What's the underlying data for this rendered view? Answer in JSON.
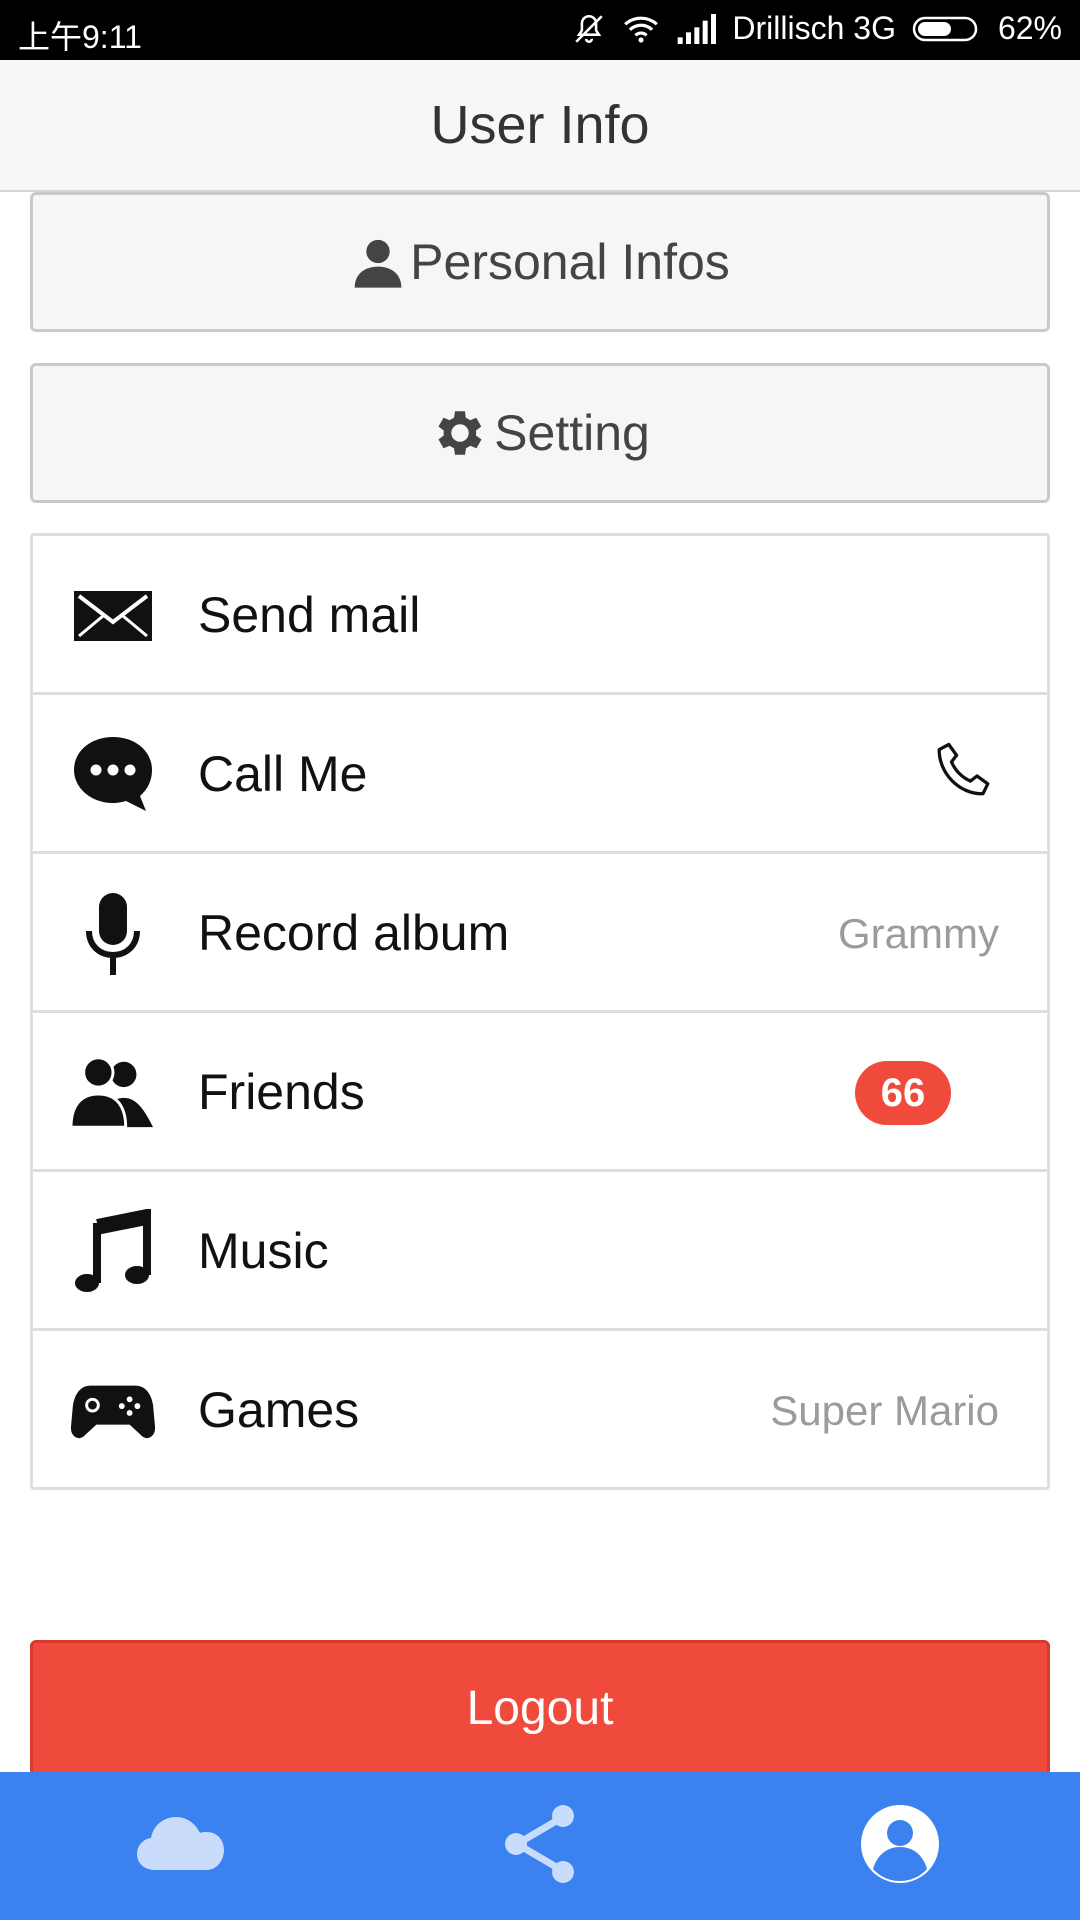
{
  "status_bar": {
    "time": "上午9:11",
    "carrier": "Drillisch 3G",
    "battery": "62%",
    "battery_level": 0.62,
    "icons": [
      "bell-off-icon",
      "wifi-icon",
      "signal-icon",
      "battery-icon"
    ]
  },
  "header": {
    "title": "User Info"
  },
  "buttons": {
    "personal": {
      "label": "Personal Infos",
      "icon": "person-icon"
    },
    "setting": {
      "label": "Setting",
      "icon": "gear-icon"
    }
  },
  "list": {
    "items": [
      {
        "label": "Send mail",
        "icon": "envelope-icon"
      },
      {
        "label": "Call Me",
        "icon": "chat-bubble-icon",
        "accessory": "phone-icon"
      },
      {
        "label": "Record album",
        "icon": "microphone-icon",
        "detail": "Grammy"
      },
      {
        "label": "Friends",
        "icon": "friends-icon",
        "badge": "66"
      },
      {
        "label": "Music",
        "icon": "music-note-icon"
      },
      {
        "label": "Games",
        "icon": "gamepad-icon",
        "detail": "Super Mario"
      }
    ]
  },
  "logout": {
    "label": "Logout"
  },
  "colors": {
    "danger": "#ef4a3c",
    "tabbar": "#3b82f0",
    "badge": "#ef4a3c"
  },
  "tabbar": {
    "tabs": [
      {
        "icon": "cloud-icon"
      },
      {
        "icon": "share-icon"
      },
      {
        "icon": "user-profile-icon"
      }
    ]
  }
}
